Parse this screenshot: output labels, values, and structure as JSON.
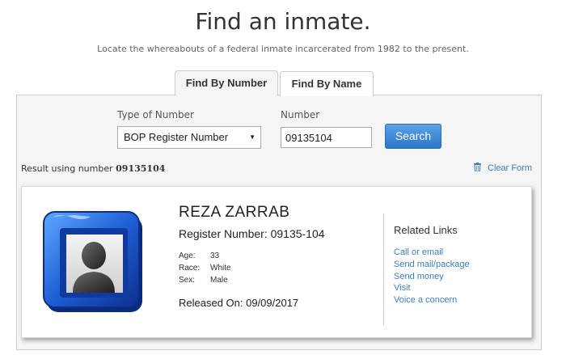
{
  "header": {
    "title": "Find an inmate.",
    "subtitle": "Locate the whereabouts of a federal inmate incarcerated from 1982 to the present."
  },
  "tabs": [
    {
      "label": "Find By Number",
      "active": true
    },
    {
      "label": "Find By Name",
      "active": false
    }
  ],
  "form": {
    "type_label": "Type of Number",
    "type_value": "BOP Register Number",
    "number_label": "Number",
    "number_value": "09135104",
    "search_label": "Search"
  },
  "result": {
    "prefix": "Result using number",
    "number": "09135104",
    "clear_label": "Clear Form"
  },
  "inmate": {
    "name": "REZA ZARRAB",
    "register": "Register Number: 09135-104",
    "age_label": "Age:",
    "age": "33",
    "race_label": "Race:",
    "race": "White",
    "sex_label": "Sex:",
    "sex": "Male",
    "released": "Released On: 09/09/2017"
  },
  "related": {
    "title": "Related Links",
    "links": [
      "Call or email",
      "Send mail/package",
      "Send money",
      "Visit",
      "Voice a concern"
    ]
  },
  "colors": {
    "accent": "#3a7fc1",
    "button": "#2b78c8",
    "panel_bg": "#f5f5f5",
    "avatar_frame": "#1f5fd6"
  },
  "icons": {
    "clear": "trash-icon",
    "avatar": "person-silhouette-icon",
    "select": "caret-down-icon"
  }
}
